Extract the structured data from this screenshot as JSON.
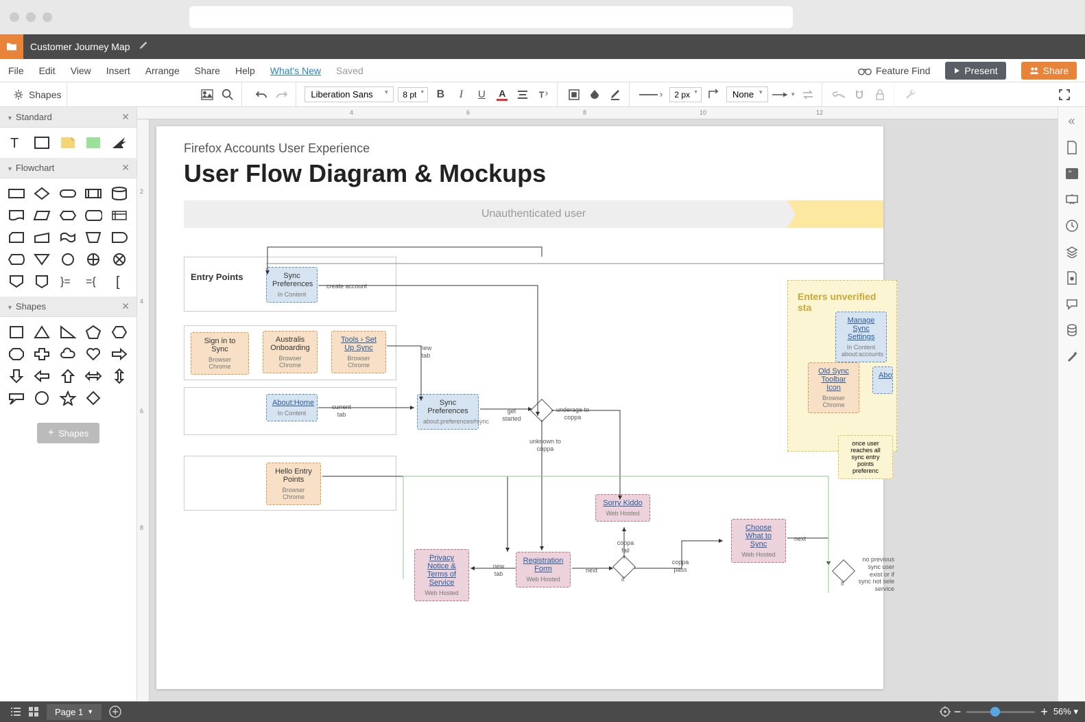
{
  "document": {
    "title": "Customer Journey Map"
  },
  "menubar": {
    "items": [
      "File",
      "Edit",
      "View",
      "Insert",
      "Arrange",
      "Share",
      "Help"
    ],
    "whatsnew": "What's New",
    "saved": "Saved",
    "feature_find": "Feature Find",
    "present": "Present",
    "share": "Share"
  },
  "toolbar": {
    "shapes_label": "Shapes",
    "font": "Liberation Sans",
    "font_size": "8 pt",
    "stroke_width": "2 px",
    "fill_mode": "None"
  },
  "sidebar": {
    "panels": {
      "standard": "Standard",
      "flowchart": "Flowchart",
      "shapes": "Shapes"
    },
    "add_shapes": "Shapes"
  },
  "rulerH": [
    "4",
    "6",
    "8",
    "10",
    "12"
  ],
  "rulerV": [
    "2",
    "4",
    "6",
    "8"
  ],
  "canvas": {
    "subtitle": "Firefox Accounts User Experience",
    "title": "User Flow Diagram & Mockups",
    "banner": "Unauthenticated user",
    "section_label": "Entry Points",
    "nodes": {
      "sync_prefs_1": {
        "title": "Sync Preferences",
        "sub": "In Content"
      },
      "sign_in": {
        "title": "Sign in to Sync",
        "sub": "Browser Chrome"
      },
      "australis": {
        "title": "Australis Onboarding",
        "sub": "Browser Chrome"
      },
      "tools": {
        "title": "Tools › Set Up Sync",
        "sub": "Browser Chrome"
      },
      "about_home": {
        "title": "About:Home",
        "sub": "In Content"
      },
      "sync_prefs_2": {
        "title": "Sync Preferences",
        "sub": "about:preferences#sync"
      },
      "hello": {
        "title": "Hello Entry Points",
        "sub": "Browser Chrome"
      },
      "sorry": {
        "title": "Sorry Kiddo",
        "sub": "Web Hosted"
      },
      "choose": {
        "title": "Choose What to Sync",
        "sub": "Web Hosted"
      },
      "privacy": {
        "title": "Privacy Notice & Terms of Service",
        "sub": "Web Hosted"
      },
      "reg": {
        "title": "Registration Form",
        "sub": "Web Hosted"
      },
      "unverified": "Enters unverified sta",
      "manage": {
        "title": "Manage Sync Settings",
        "sub": "In Content about:accounts"
      },
      "old_sync": {
        "title": "Old Sync Toolbar Icon",
        "sub": "Browser Chrome"
      },
      "abo": "Abo",
      "yellow_note": "once user reaches all sync entry points preferenc"
    },
    "edges": {
      "create_account": "create account",
      "new_tab": "new tab",
      "current_tab": "current tab",
      "get_started": "get started",
      "underage": "underage to coppa",
      "unknown": "unknown to coppa",
      "coppa_fail": "coppa fail",
      "coppa_pass": "coppa pass",
      "next": "next",
      "if": "if",
      "no_previous": "no previous sync user exist or if sync not sele service"
    }
  },
  "bottombar": {
    "page_tab": "Page 1",
    "zoom": "56%"
  }
}
